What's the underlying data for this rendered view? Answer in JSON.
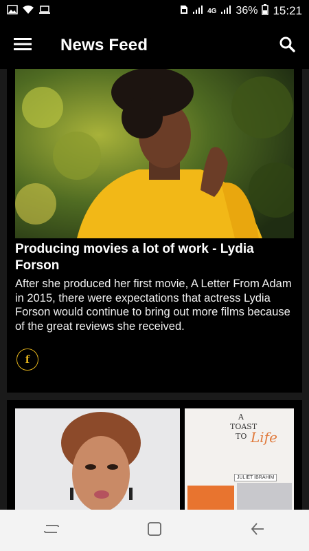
{
  "status": {
    "battery_pct": "36%",
    "time": "15:21",
    "network": "4G"
  },
  "app_bar": {
    "title": "News Feed",
    "menu_icon": "hamburger-menu-icon",
    "search_icon": "search-icon"
  },
  "articles": [
    {
      "headline": "Producing movies a lot of work - Lydia Forson",
      "summary": "After she produced her first movie, A Letter From Adam in 2015, there were expectations that actress Lydia Forson would continue to bring out more films because of the great reviews she received.",
      "share_icon": "facebook-icon",
      "share_glyph": "f"
    },
    {
      "book_title_line1": "A",
      "book_title_line2": "TOAST",
      "book_title_line3": "TO",
      "book_title_script": "Life",
      "book_author": "JULIET IBRAHIM"
    }
  ],
  "colors": {
    "accent": "#e2b21b",
    "background": "#000000",
    "feed_bg": "#1a1a1a",
    "nav_bg": "#f3f3f3"
  }
}
